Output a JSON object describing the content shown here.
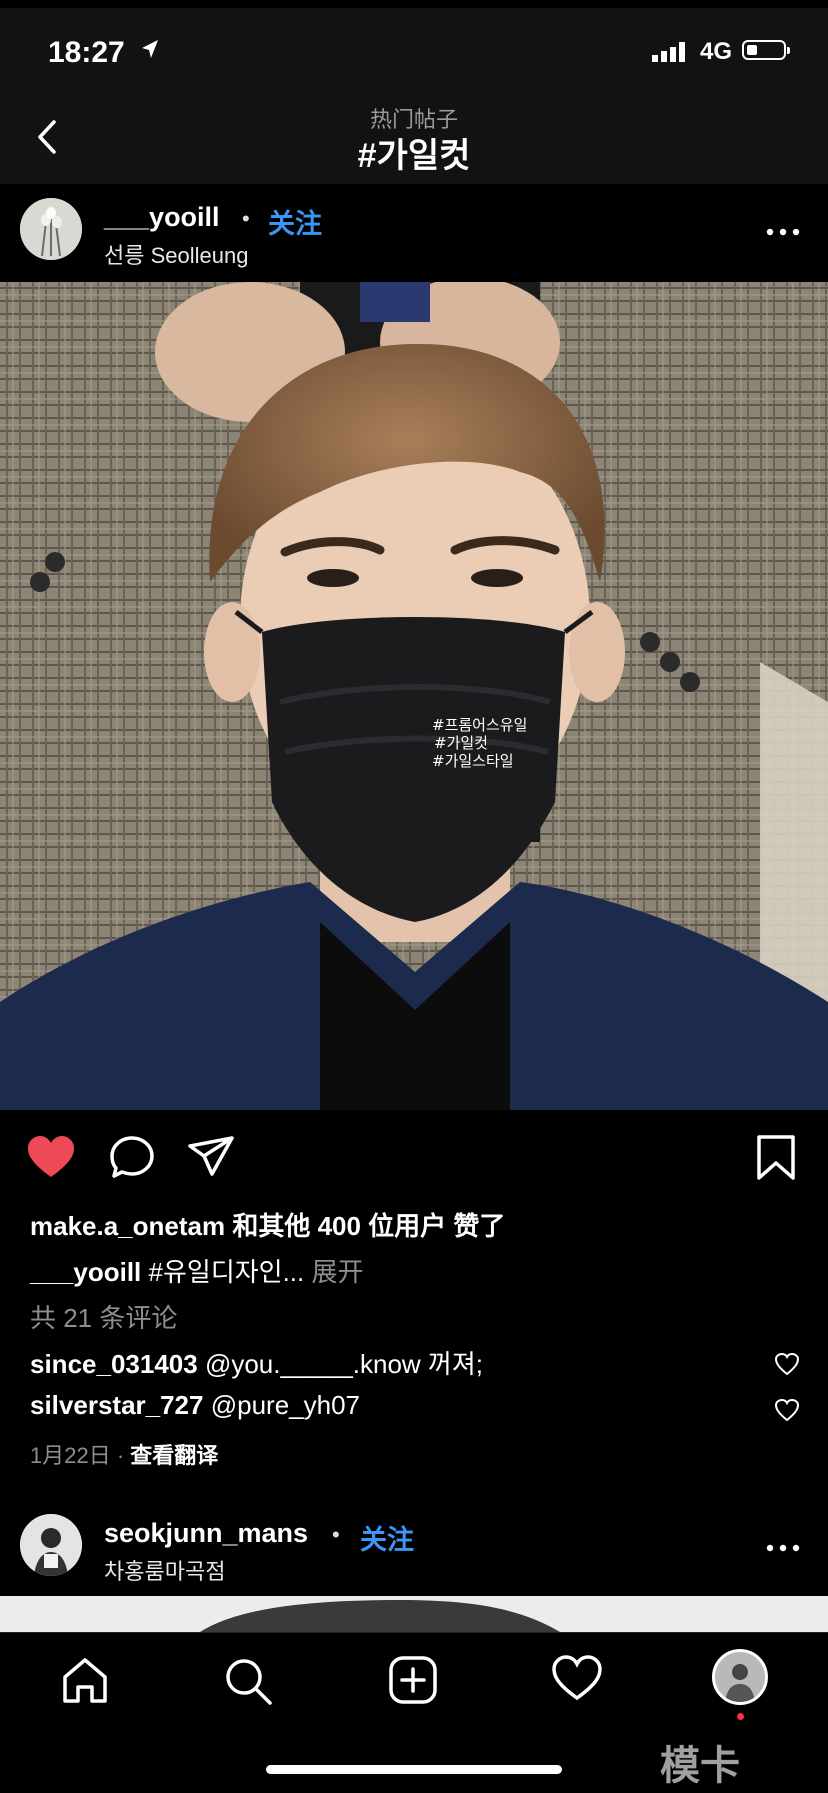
{
  "status": {
    "time": "18:27",
    "network": "4G"
  },
  "nav": {
    "subtitle": "热门帖子",
    "title": "#가일컷"
  },
  "post": {
    "username": "___yooill",
    "separator": "•",
    "follow_label": "关注",
    "location": "선릉 Seolleung",
    "mask_tags": [
      "#프롬어스유일",
      "#가일컷",
      "#가일스타일"
    ],
    "likes": {
      "user": "make.a_onetam",
      "text": "和其他 400 位用户 赞了"
    },
    "caption": {
      "user": "___yooill",
      "text": "#유일디자인...",
      "more": "展开"
    },
    "comments_count": "共 21 条评论",
    "comments": [
      {
        "user": "since_031403",
        "text": "@you._____.know 꺼져;"
      },
      {
        "user": "silverstar_727",
        "text": "@pure_yh07"
      }
    ],
    "date": "1月22日",
    "date_sep": "·",
    "translate": "查看翻译"
  },
  "next_post": {
    "username": "seokjunn_mans",
    "separator": "•",
    "follow_label": "关注",
    "location": "차홍룸마곡점"
  },
  "tab_bar": {
    "tabs": [
      "home-icon",
      "search-icon",
      "add-post-icon",
      "activity-heart-icon",
      "profile-avatar"
    ],
    "watermark": "模卡"
  },
  "colors": {
    "accent": "#3d95f5",
    "like": "#ed4956",
    "background": "#000000"
  }
}
